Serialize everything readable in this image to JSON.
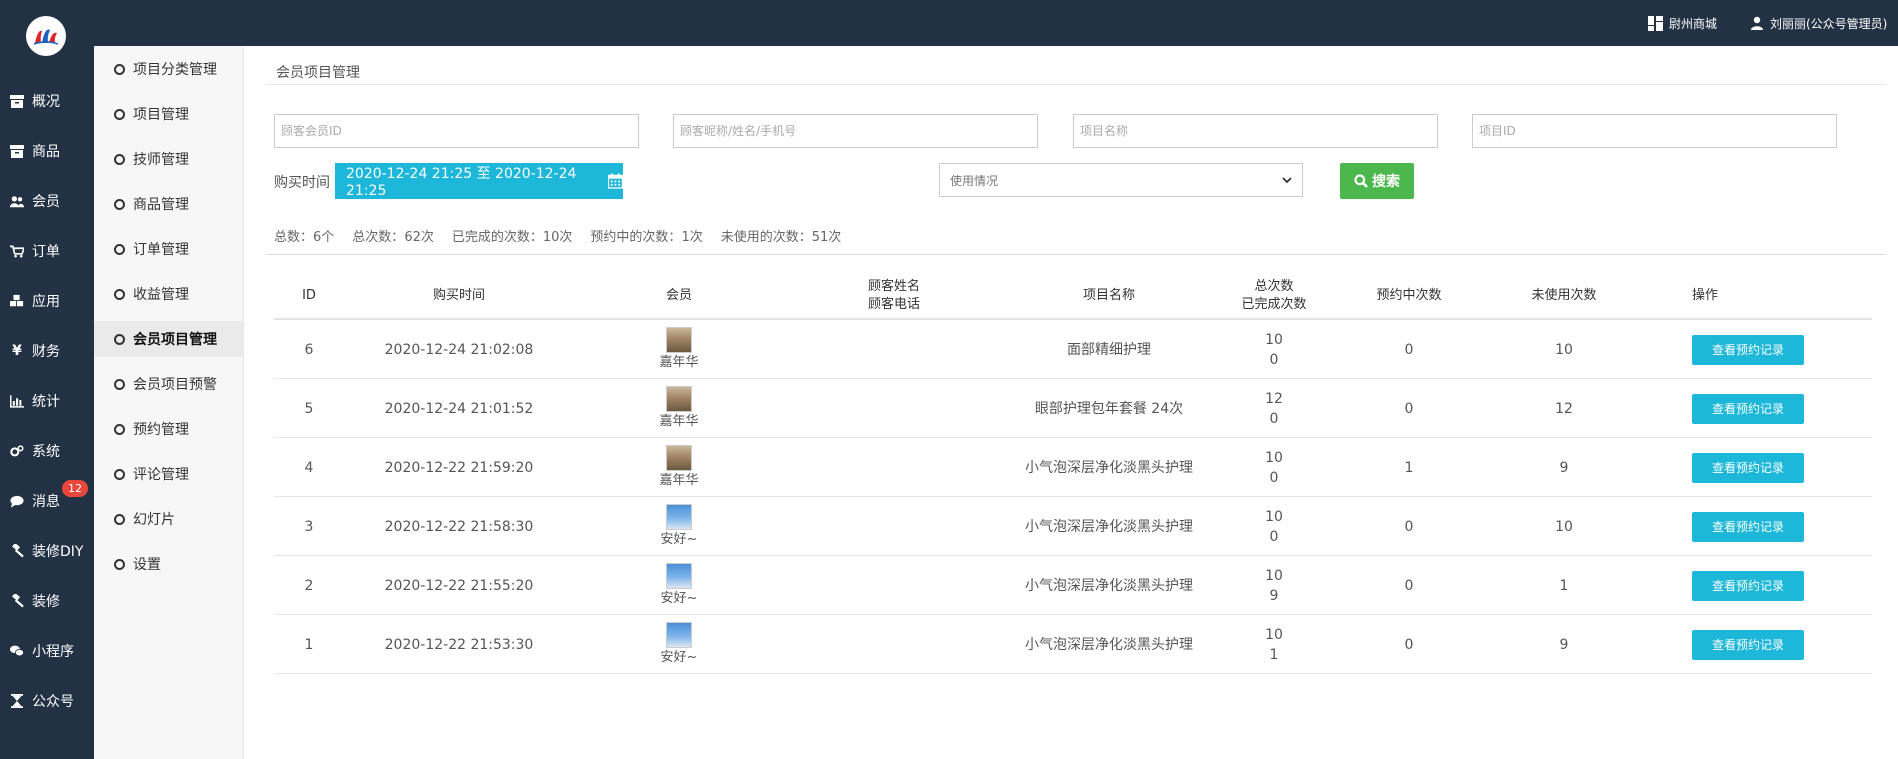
{
  "topbar": {
    "shop_label": "尉州商城",
    "user_label": "刘丽丽(公众号管理员)"
  },
  "leftnav": {
    "items": [
      {
        "label": "概况",
        "icon": "box-icon"
      },
      {
        "label": "商品",
        "icon": "archive-icon"
      },
      {
        "label": "会员",
        "icon": "users-icon"
      },
      {
        "label": "订单",
        "icon": "cart-icon"
      },
      {
        "label": "应用",
        "icon": "cubes-icon"
      },
      {
        "label": "财务",
        "icon": "yen-icon"
      },
      {
        "label": "统计",
        "icon": "bar-chart-icon"
      },
      {
        "label": "系统",
        "icon": "gears-icon"
      },
      {
        "label": "消息",
        "icon": "chat-icon"
      },
      {
        "label": "装修DIY",
        "icon": "gavel-icon"
      },
      {
        "label": "装修",
        "icon": "gavel-icon"
      },
      {
        "label": "小程序",
        "icon": "wechat-icon"
      },
      {
        "label": "公众号",
        "icon": "hourglass-icon"
      }
    ],
    "message_badge": "12"
  },
  "subnav": {
    "items": [
      {
        "label": "项目分类管理"
      },
      {
        "label": "项目管理"
      },
      {
        "label": "技师管理"
      },
      {
        "label": "商品管理"
      },
      {
        "label": "订单管理"
      },
      {
        "label": "收益管理"
      },
      {
        "label": "会员项目管理"
      },
      {
        "label": "会员项目预警"
      },
      {
        "label": "预约管理"
      },
      {
        "label": "评论管理"
      },
      {
        "label": "幻灯片"
      },
      {
        "label": "设置"
      }
    ],
    "active_index": 6
  },
  "page": {
    "title": "会员项目管理"
  },
  "filters": {
    "member_id_placeholder": "顾客会员ID",
    "member_name_placeholder": "顾客昵称/姓名/手机号",
    "project_name_placeholder": "项目名称",
    "project_id_placeholder": "项目ID",
    "time_label": "购买时间",
    "date_range": "2020-12-24 21:25 至 2020-12-24 21:25",
    "usage_select": "使用情况",
    "search_label": "搜索"
  },
  "stats": {
    "total_label": "总数：",
    "total_value": "6个",
    "times_label": "总次数：",
    "times_value": "62次",
    "done_label": "已完成的次数：",
    "done_value": "10次",
    "booking_label": "预约中的次数：",
    "booking_value": "1次",
    "unused_label": "未使用的次数：",
    "unused_value": "51次"
  },
  "table": {
    "headers": {
      "id": "ID",
      "time": "购买时间",
      "member": "会员",
      "cust_name": "顾客姓名",
      "cust_phone": "顾客电话",
      "project": "项目名称",
      "total": "总次数",
      "done": "已完成次数",
      "booking": "预约中次数",
      "unused": "未使用次数",
      "action": "操作"
    },
    "rows": [
      {
        "id": "6",
        "time": "2020-12-24 21:02:08",
        "member": "嘉年华",
        "avatar": "a",
        "project": "面部精细护理",
        "total": "10",
        "done": "0",
        "booking": "0",
        "unused": "10",
        "action": "查看预约记录"
      },
      {
        "id": "5",
        "time": "2020-12-24 21:01:52",
        "member": "嘉年华",
        "avatar": "a",
        "project": "眼部护理包年套餐 24次",
        "total": "12",
        "done": "0",
        "booking": "0",
        "unused": "12",
        "action": "查看预约记录"
      },
      {
        "id": "4",
        "time": "2020-12-22 21:59:20",
        "member": "嘉年华",
        "avatar": "a",
        "project": "小气泡深层净化淡黑头护理",
        "total": "10",
        "done": "0",
        "booking": "1",
        "unused": "9",
        "action": "查看预约记录"
      },
      {
        "id": "3",
        "time": "2020-12-22 21:58:30",
        "member": "安好~",
        "avatar": "b",
        "project": "小气泡深层净化淡黑头护理",
        "total": "10",
        "done": "0",
        "booking": "0",
        "unused": "10",
        "action": "查看预约记录"
      },
      {
        "id": "2",
        "time": "2020-12-22 21:55:20",
        "member": "安好~",
        "avatar": "b",
        "project": "小气泡深层净化淡黑头护理",
        "total": "10",
        "done": "9",
        "booking": "0",
        "unused": "1",
        "action": "查看预约记录"
      },
      {
        "id": "1",
        "time": "2020-12-22 21:53:30",
        "member": "安好~",
        "avatar": "b",
        "project": "小气泡深层净化淡黑头护理",
        "total": "10",
        "done": "1",
        "booking": "0",
        "unused": "9",
        "action": "查看预约记录"
      }
    ]
  },
  "colors": {
    "sidebar_bg": "#223244",
    "accent_cyan": "#1cb7d9",
    "search_green": "#4cb74c",
    "badge_red": "#e9473c"
  }
}
